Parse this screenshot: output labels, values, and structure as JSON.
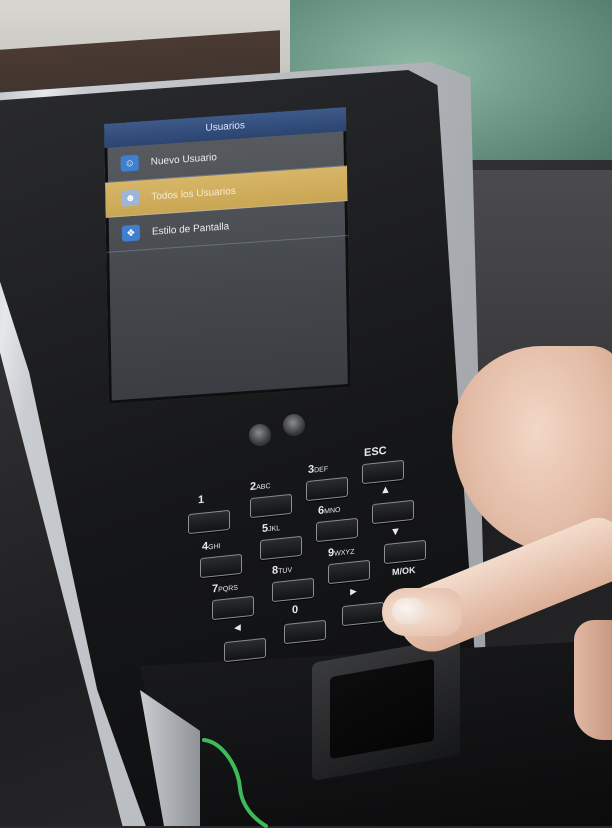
{
  "screen": {
    "title": "Usuarios",
    "menu_items": [
      {
        "label": "Nuevo Usuario",
        "icon": "add-user-icon",
        "selected": false
      },
      {
        "label": "Todos los Usuarios",
        "icon": "user-list-icon",
        "selected": true
      },
      {
        "label": "Estilo de Pantalla",
        "icon": "display-style-icon",
        "selected": false
      }
    ]
  },
  "keypad": {
    "keys": [
      {
        "label": "1",
        "sub": ""
      },
      {
        "label": "2",
        "sub": "ABC"
      },
      {
        "label": "3",
        "sub": "DEF"
      },
      {
        "label": "ESC",
        "sub": ""
      },
      {
        "label": "4",
        "sub": "GHI"
      },
      {
        "label": "5",
        "sub": "JKL"
      },
      {
        "label": "6",
        "sub": "MNO"
      },
      {
        "label": "▲",
        "sub": ""
      },
      {
        "label": "7",
        "sub": "PQRS"
      },
      {
        "label": "8",
        "sub": "TUV"
      },
      {
        "label": "9",
        "sub": "WXYZ"
      },
      {
        "label": "▼",
        "sub": ""
      },
      {
        "label": "◄",
        "sub": ""
      },
      {
        "label": "0",
        "sub": ""
      },
      {
        "label": "►",
        "sub": ""
      },
      {
        "label": "M/OK",
        "sub": ""
      }
    ]
  },
  "colors": {
    "selected_row": "#d7b669",
    "header": "#2c4470",
    "led": "#3dbb5a"
  }
}
